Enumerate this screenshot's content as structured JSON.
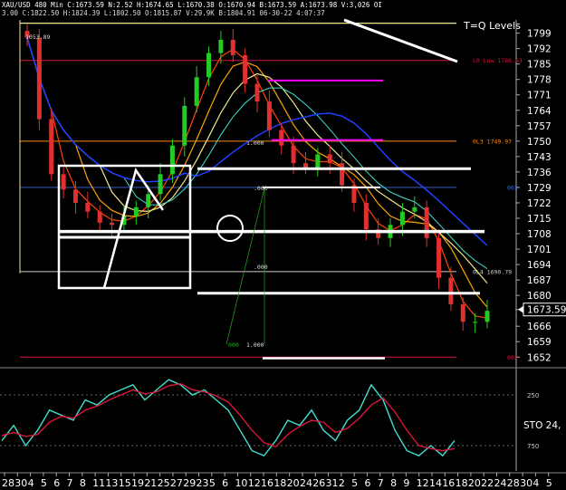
{
  "header": {
    "line1": "XAU/USD  480  Min  C:1673.59  N:2.52  H:1674.65  L:1670.38  O:1670.94  B:1673.59  A:1673.98  V:3,026  OI",
    "line2": "3.00  C:1822.50  H:1824.39  L:1802.50  O:1815.87  V:29.9K  B:1804.91  06-30-22  4:07:37"
  },
  "chart_data": [
    {
      "type": "candlestick",
      "symbol": "XAU/USD",
      "interval": "480 Min",
      "title": "T=Q Levels",
      "price_axis": {
        "ticks": [
          1799,
          1792,
          1785,
          1778,
          1771,
          1764,
          1757,
          1750,
          1743,
          1736,
          1729,
          1722,
          1715,
          1708,
          1701,
          1694,
          1687,
          1680,
          1673.59,
          1666,
          1659,
          1652
        ],
        "range": [
          1648,
          1805
        ]
      },
      "last_price": "1673.59",
      "x_tick_labels": [
        "28",
        "30",
        "4",
        "5",
        "6",
        "7",
        "8",
        "11",
        "13",
        "15",
        "19",
        "21",
        "25",
        "27",
        "29",
        "23",
        "5",
        "6",
        "10",
        "12",
        "16",
        "18",
        "20",
        "24",
        "26",
        "31",
        "2",
        "5",
        "6",
        "7",
        "8",
        "9",
        "12",
        "14",
        "16",
        "18",
        "20",
        "22",
        "24",
        "28",
        "30",
        "4",
        "5"
      ],
      "levels": [
        {
          "label": "L0 Low 1786.63",
          "price": 1786.63,
          "color": "#dc143c"
        },
        {
          "label": "0L3 1749.97",
          "price": 1749.97,
          "color": "#ff8c00"
        },
        {
          "label": "0L4 1690.79",
          "price": 1690.79,
          "color": "#cccccc"
        },
        {
          "label": "003",
          "price": 1729,
          "color": "#4169e1"
        },
        {
          "label": "002",
          "price": 1652,
          "color": "#dc143c"
        }
      ],
      "annotations": [
        "1.000",
        ".000",
        ".000",
        "1.000",
        "000",
        "1053.89"
      ],
      "series": [
        {
          "name": "",
          "values": [
            1797,
            1760,
            1735,
            1728,
            1722,
            1718,
            1713,
            1712,
            1716,
            1720,
            1726,
            1735,
            1748,
            1766,
            1779,
            1790,
            1796,
            1789,
            1776,
            1768,
            1755,
            1748,
            1740,
            1738,
            1744,
            1740,
            1730,
            1722,
            1710,
            1706,
            1712,
            1718,
            1720,
            1706,
            1688,
            1676,
            1668,
            1668,
            1673
          ]
        }
      ]
    },
    {
      "type": "line",
      "title": "STO",
      "label_text": "STO  24,",
      "ticks": [
        "250",
        "750"
      ],
      "series": [
        {
          "name": "",
          "color": "#40e0d0",
          "values": [
            30,
            45,
            25,
            40,
            60,
            55,
            50,
            70,
            65,
            75,
            80,
            85,
            70,
            80,
            90,
            85,
            75,
            80,
            70,
            60,
            40,
            20,
            15,
            30,
            50,
            45,
            60,
            40,
            30,
            50,
            60,
            85,
            70,
            40,
            20,
            15,
            25,
            15,
            30
          ]
        },
        {
          "name": "",
          "color": "#dc143c",
          "values": [
            35,
            38,
            34,
            36,
            48,
            54,
            52,
            60,
            64,
            70,
            75,
            80,
            76,
            78,
            84,
            86,
            80,
            78,
            74,
            68,
            55,
            40,
            28,
            24,
            36,
            44,
            50,
            48,
            38,
            42,
            52,
            65,
            72,
            58,
            40,
            25,
            22,
            20,
            22
          ]
        }
      ]
    }
  ]
}
